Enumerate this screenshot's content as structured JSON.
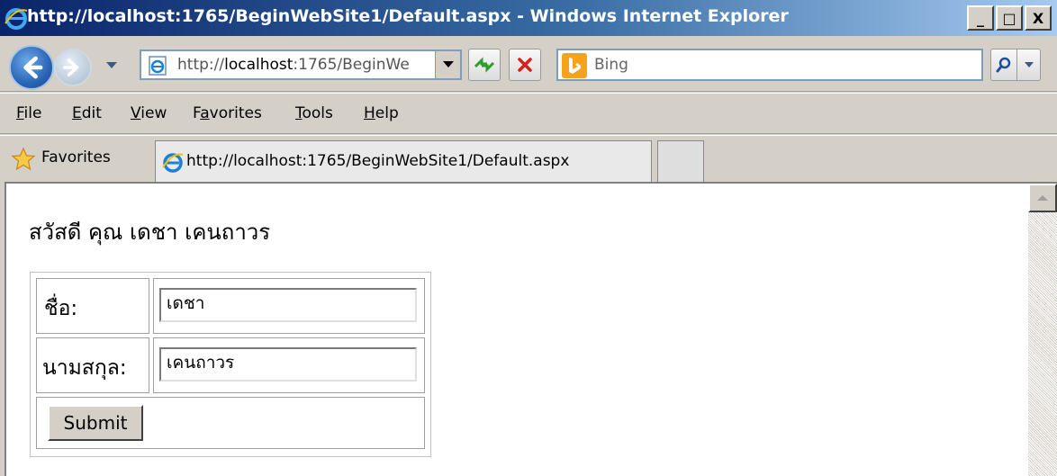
{
  "window": {
    "title": "http://localhost:1765/BeginWebSite1/Default.aspx - Windows Internet Explorer",
    "minimize_label": "_",
    "maximize_label": "□",
    "close_label": "X"
  },
  "navigation": {
    "address_prefix": "http://",
    "address_host": "localhost",
    "address_suffix": ":1765/BeginWe",
    "search_placeholder": "Bing"
  },
  "menu": {
    "items": [
      {
        "label": "File",
        "accel": "F",
        "rest": "ile"
      },
      {
        "label": "Edit",
        "accel": "E",
        "rest": "dit"
      },
      {
        "label": "View",
        "accel": "V",
        "rest": "iew"
      },
      {
        "label": "Favorites",
        "pre": "F",
        "accel": "a",
        "rest": "vorites"
      },
      {
        "label": "Tools",
        "accel": "T",
        "rest": "ools"
      },
      {
        "label": "Help",
        "accel": "H",
        "rest": "elp"
      }
    ]
  },
  "favorites_bar": {
    "favorites_label": "Favorites",
    "tab_title": "http://localhost:1765/BeginWebSite1/Default.aspx"
  },
  "page": {
    "greeting": "สวัสดี คุณ เดชา เคนถาวร",
    "first_name_label": "ชื่อ:",
    "first_name_value": "เดชา",
    "last_name_label": "นามสกุล:",
    "last_name_value": "เคนถาวร",
    "submit_label": "Submit"
  },
  "colors": {
    "titlebar_start": "#0a246a",
    "titlebar_end": "#a6caf0",
    "chrome": "#d4d0c8"
  }
}
